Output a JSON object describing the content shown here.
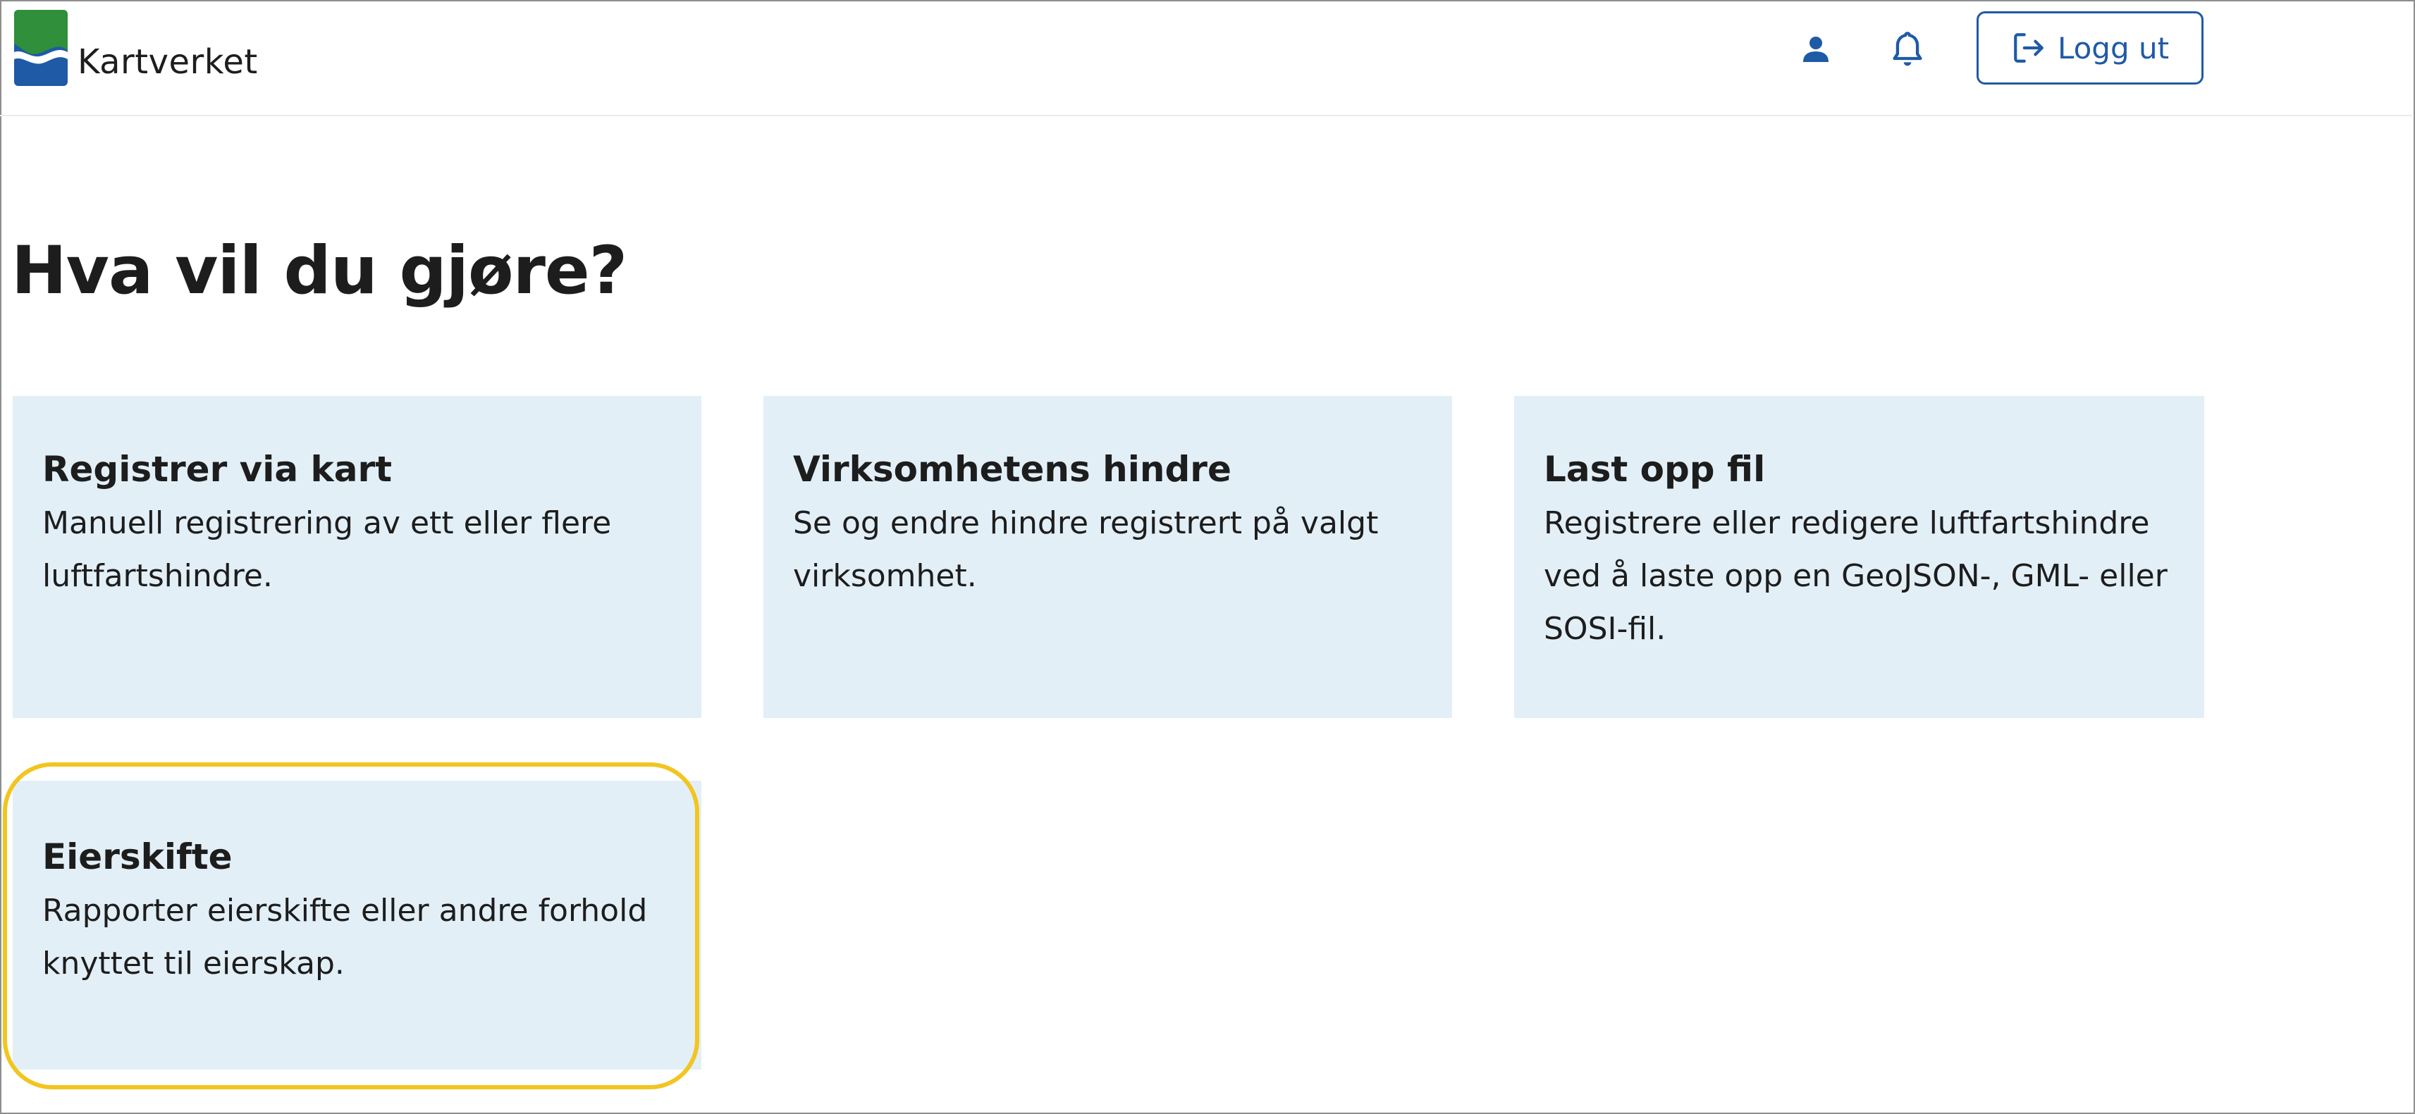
{
  "header": {
    "logo_text": "Kartverket",
    "logo_colors": {
      "green": "#2f8f3a",
      "blue": "#1f5aa6"
    },
    "user_icon": "user-icon",
    "bell_icon": "bell-icon",
    "logout_label": "Logg ut",
    "logout_icon": "logout-icon",
    "accent_color": "#1f5aa6"
  },
  "main": {
    "title": "Hva vil du gjøre?",
    "cards": [
      {
        "title": "Registrer via kart",
        "description": "Manuell registrering av ett eller flere luftfartshindre."
      },
      {
        "title": "Virksomhetens hindre",
        "description": "Se og endre hindre registrert på valgt virksomhet."
      },
      {
        "title": "Last opp fil",
        "description": "Registrere eller redigere luftfartshindre ved å laste opp en GeoJSON-, GML- eller SOSI-fil."
      },
      {
        "title": "Eierskifte",
        "description": "Rapporter eierskifte eller andre forhold knyttet til eierskap."
      }
    ],
    "card_background": "#e3eff7",
    "highlight_color": "#f2c51f"
  }
}
